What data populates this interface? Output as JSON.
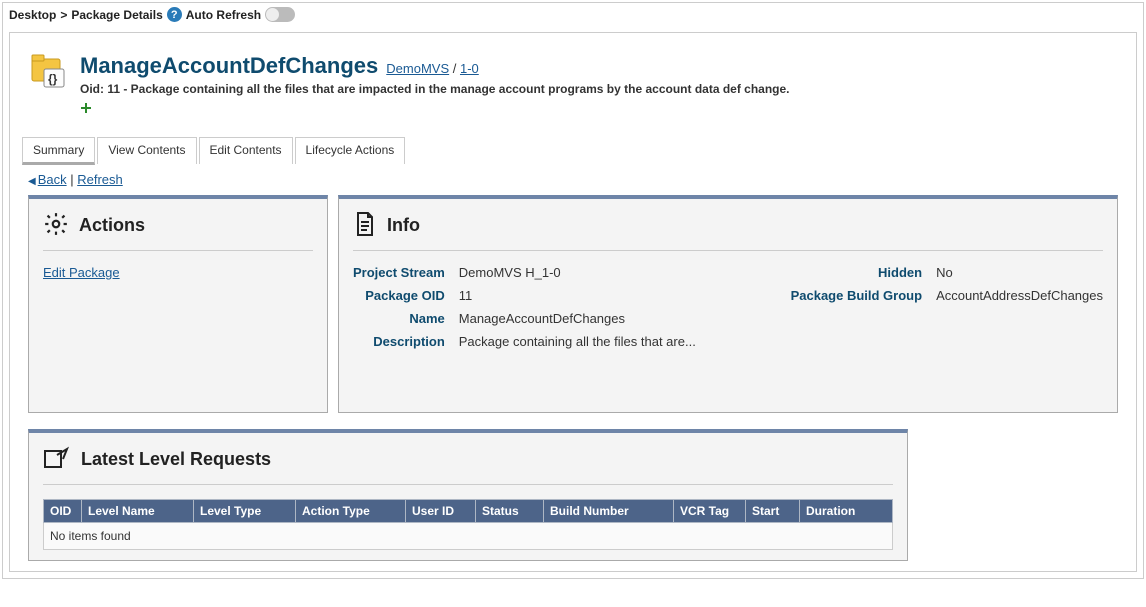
{
  "topbar": {
    "breadcrumb1": "Desktop",
    "breadcrumb2": "Package Details",
    "auto_refresh_label": "Auto Refresh"
  },
  "header": {
    "title": "ManageAccountDefChanges",
    "crumb1": "DemoMVS",
    "crumb_sep": " / ",
    "crumb2": "1-0",
    "subtitle": "Oid: 11 - Package containing all the files that are impacted in the manage account programs by the account data def change."
  },
  "tabs": {
    "summary": "Summary",
    "view_contents": "View Contents",
    "edit_contents": "Edit Contents",
    "lifecycle_actions": "Lifecycle Actions"
  },
  "nav": {
    "back": "Back",
    "sep": " | ",
    "refresh": "Refresh"
  },
  "actions": {
    "title": "Actions",
    "edit_package": "Edit Package"
  },
  "info": {
    "title": "Info",
    "labels": {
      "project_stream": "Project Stream",
      "package_oid": "Package OID",
      "name": "Name",
      "description": "Description",
      "hidden": "Hidden",
      "package_build_group": "Package Build Group"
    },
    "values": {
      "project_stream": "DemoMVS H_1-0",
      "package_oid": "11",
      "name": "ManageAccountDefChanges",
      "description": "Package containing all the files that are...",
      "hidden": "No",
      "package_build_group": "AccountAddressDefChanges"
    }
  },
  "requests": {
    "title": "Latest Level Requests",
    "columns": {
      "oid": "OID",
      "level_name": "Level Name",
      "level_type": "Level Type",
      "action_type": "Action Type",
      "user_id": "User ID",
      "status": "Status",
      "build_number": "Build Number",
      "vcr_tag": "VCR Tag",
      "start": "Start",
      "duration": "Duration"
    },
    "empty": "No items found"
  }
}
